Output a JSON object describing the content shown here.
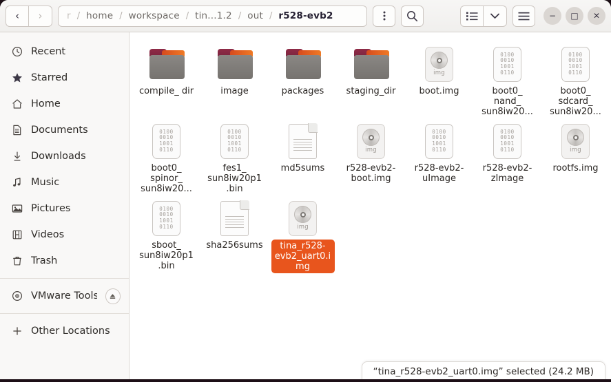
{
  "window": {
    "title": "r528-evb2"
  },
  "headerbar": {
    "back_label": "‹",
    "forward_label": "›",
    "breadcrumb": [
      {
        "label": "r",
        "state": "faded"
      },
      {
        "label": "home",
        "state": "normal"
      },
      {
        "label": "workspace",
        "state": "normal"
      },
      {
        "label": "tin...1.2",
        "state": "normal"
      },
      {
        "label": "out",
        "state": "normal"
      },
      {
        "label": "r528-evb2",
        "state": "current"
      }
    ],
    "separator": "/",
    "menu_icon": "kebab-menu-icon",
    "search_icon": "search-icon",
    "view_list_icon": "list-view-icon",
    "view_dropdown_icon": "chevron-down-icon",
    "hamburger_icon": "hamburger-menu-icon",
    "minimize_label": "−",
    "maximize_label": "□",
    "close_label": "✕"
  },
  "sidebar": {
    "items": [
      {
        "label": "Recent",
        "icon": "clock-icon",
        "name": "sidebar-item-recent"
      },
      {
        "label": "Starred",
        "icon": "star-icon",
        "name": "sidebar-item-starred"
      },
      {
        "label": "Home",
        "icon": "home-icon",
        "name": "sidebar-item-home"
      },
      {
        "label": "Documents",
        "icon": "document-icon",
        "name": "sidebar-item-documents"
      },
      {
        "label": "Downloads",
        "icon": "download-icon",
        "name": "sidebar-item-downloads"
      },
      {
        "label": "Music",
        "icon": "music-note-icon",
        "name": "sidebar-item-music"
      },
      {
        "label": "Pictures",
        "icon": "image-icon",
        "name": "sidebar-item-pictures"
      },
      {
        "label": "Videos",
        "icon": "film-icon",
        "name": "sidebar-item-videos"
      },
      {
        "label": "Trash",
        "icon": "trash-icon",
        "name": "sidebar-item-trash"
      }
    ],
    "devices": [
      {
        "label": "VMware Tools",
        "icon": "disc-icon",
        "name": "sidebar-item-vmware-tools",
        "eject": "eject-icon"
      }
    ],
    "other": {
      "label": "Other Locations",
      "icon": "plus-icon",
      "name": "sidebar-item-other-locations"
    }
  },
  "files": [
    {
      "name": "compile_\ndir",
      "type": "folder",
      "selected": false
    },
    {
      "name": "image",
      "type": "folder",
      "selected": false
    },
    {
      "name": "packages",
      "type": "folder",
      "selected": false
    },
    {
      "name": "staging_dir",
      "type": "folder",
      "selected": false
    },
    {
      "name": "boot.img",
      "type": "img",
      "selected": false
    },
    {
      "name": "boot0_\nnand_\nsun8iw20...",
      "type": "binary",
      "selected": false
    },
    {
      "name": "boot0_\nsdcard_\nsun8iw20...",
      "type": "binary",
      "selected": false
    },
    {
      "name": "boot0_\nspinor_\nsun8iw20...",
      "type": "binary",
      "selected": false
    },
    {
      "name": "fes1_\nsun8iw20p1\n.bin",
      "type": "binary",
      "selected": false
    },
    {
      "name": "md5sums",
      "type": "text",
      "selected": false
    },
    {
      "name": "r528-evb2-\nboot.img",
      "type": "img",
      "selected": false
    },
    {
      "name": "r528-evb2-\nuImage",
      "type": "binary",
      "selected": false
    },
    {
      "name": "r528-evb2-\nzImage",
      "type": "binary",
      "selected": false
    },
    {
      "name": "rootfs.img",
      "type": "img",
      "selected": false
    },
    {
      "name": "sboot_\nsun8iw20p1\n.bin",
      "type": "binary",
      "selected": false
    },
    {
      "name": "sha256sums",
      "type": "text",
      "selected": false
    },
    {
      "name": "tina_r528-evb2_uart0.img",
      "type": "img",
      "selected": true
    }
  ],
  "icon_text": {
    "binary_lines": [
      "0100",
      "0010",
      "1001",
      "0110"
    ],
    "img_label": "img"
  },
  "statusbar": {
    "text": "“tina_r528-evb2_uart0.img” selected (24.2 MB)"
  },
  "colors": {
    "selection": "#e8551d",
    "folder_tab": "#8f2b46",
    "folder_lip": "#ef7a25",
    "headerbar": "#f2f1ef",
    "sidebar": "#f9f8f7"
  }
}
